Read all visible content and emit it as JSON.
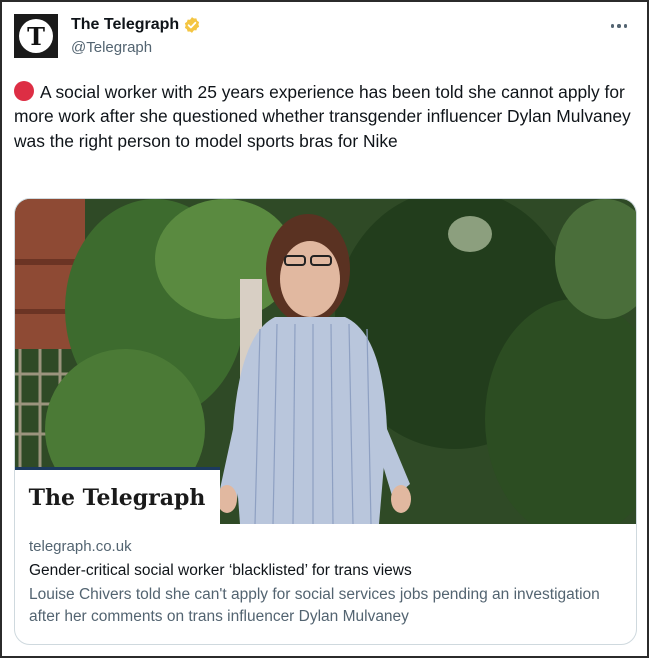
{
  "author": {
    "display_name": "The Telegraph",
    "handle": "@Telegraph",
    "avatar_letter": "T",
    "verified": true,
    "verified_color": "#f4c542"
  },
  "tweet": {
    "emoji": "red-circle",
    "text": "A social worker with 25 years experience has been told she cannot apply for more work after she questioned whether transgender influencer Dylan Mulvaney was the right person to model sports bras for Nike"
  },
  "card": {
    "logo_text": "The Telegraph",
    "domain": "telegraph.co.uk",
    "title": "Gender-critical social worker ‘blacklisted’ for trans views",
    "description": "Louise Chivers told she can't apply for social services jobs pending an investigation after her comments on trans influencer Dylan Mulvaney"
  },
  "colors": {
    "text_primary": "#0f1419",
    "text_secondary": "#536471",
    "border": "#cfd9de",
    "emoji_red": "#dd2e44"
  }
}
